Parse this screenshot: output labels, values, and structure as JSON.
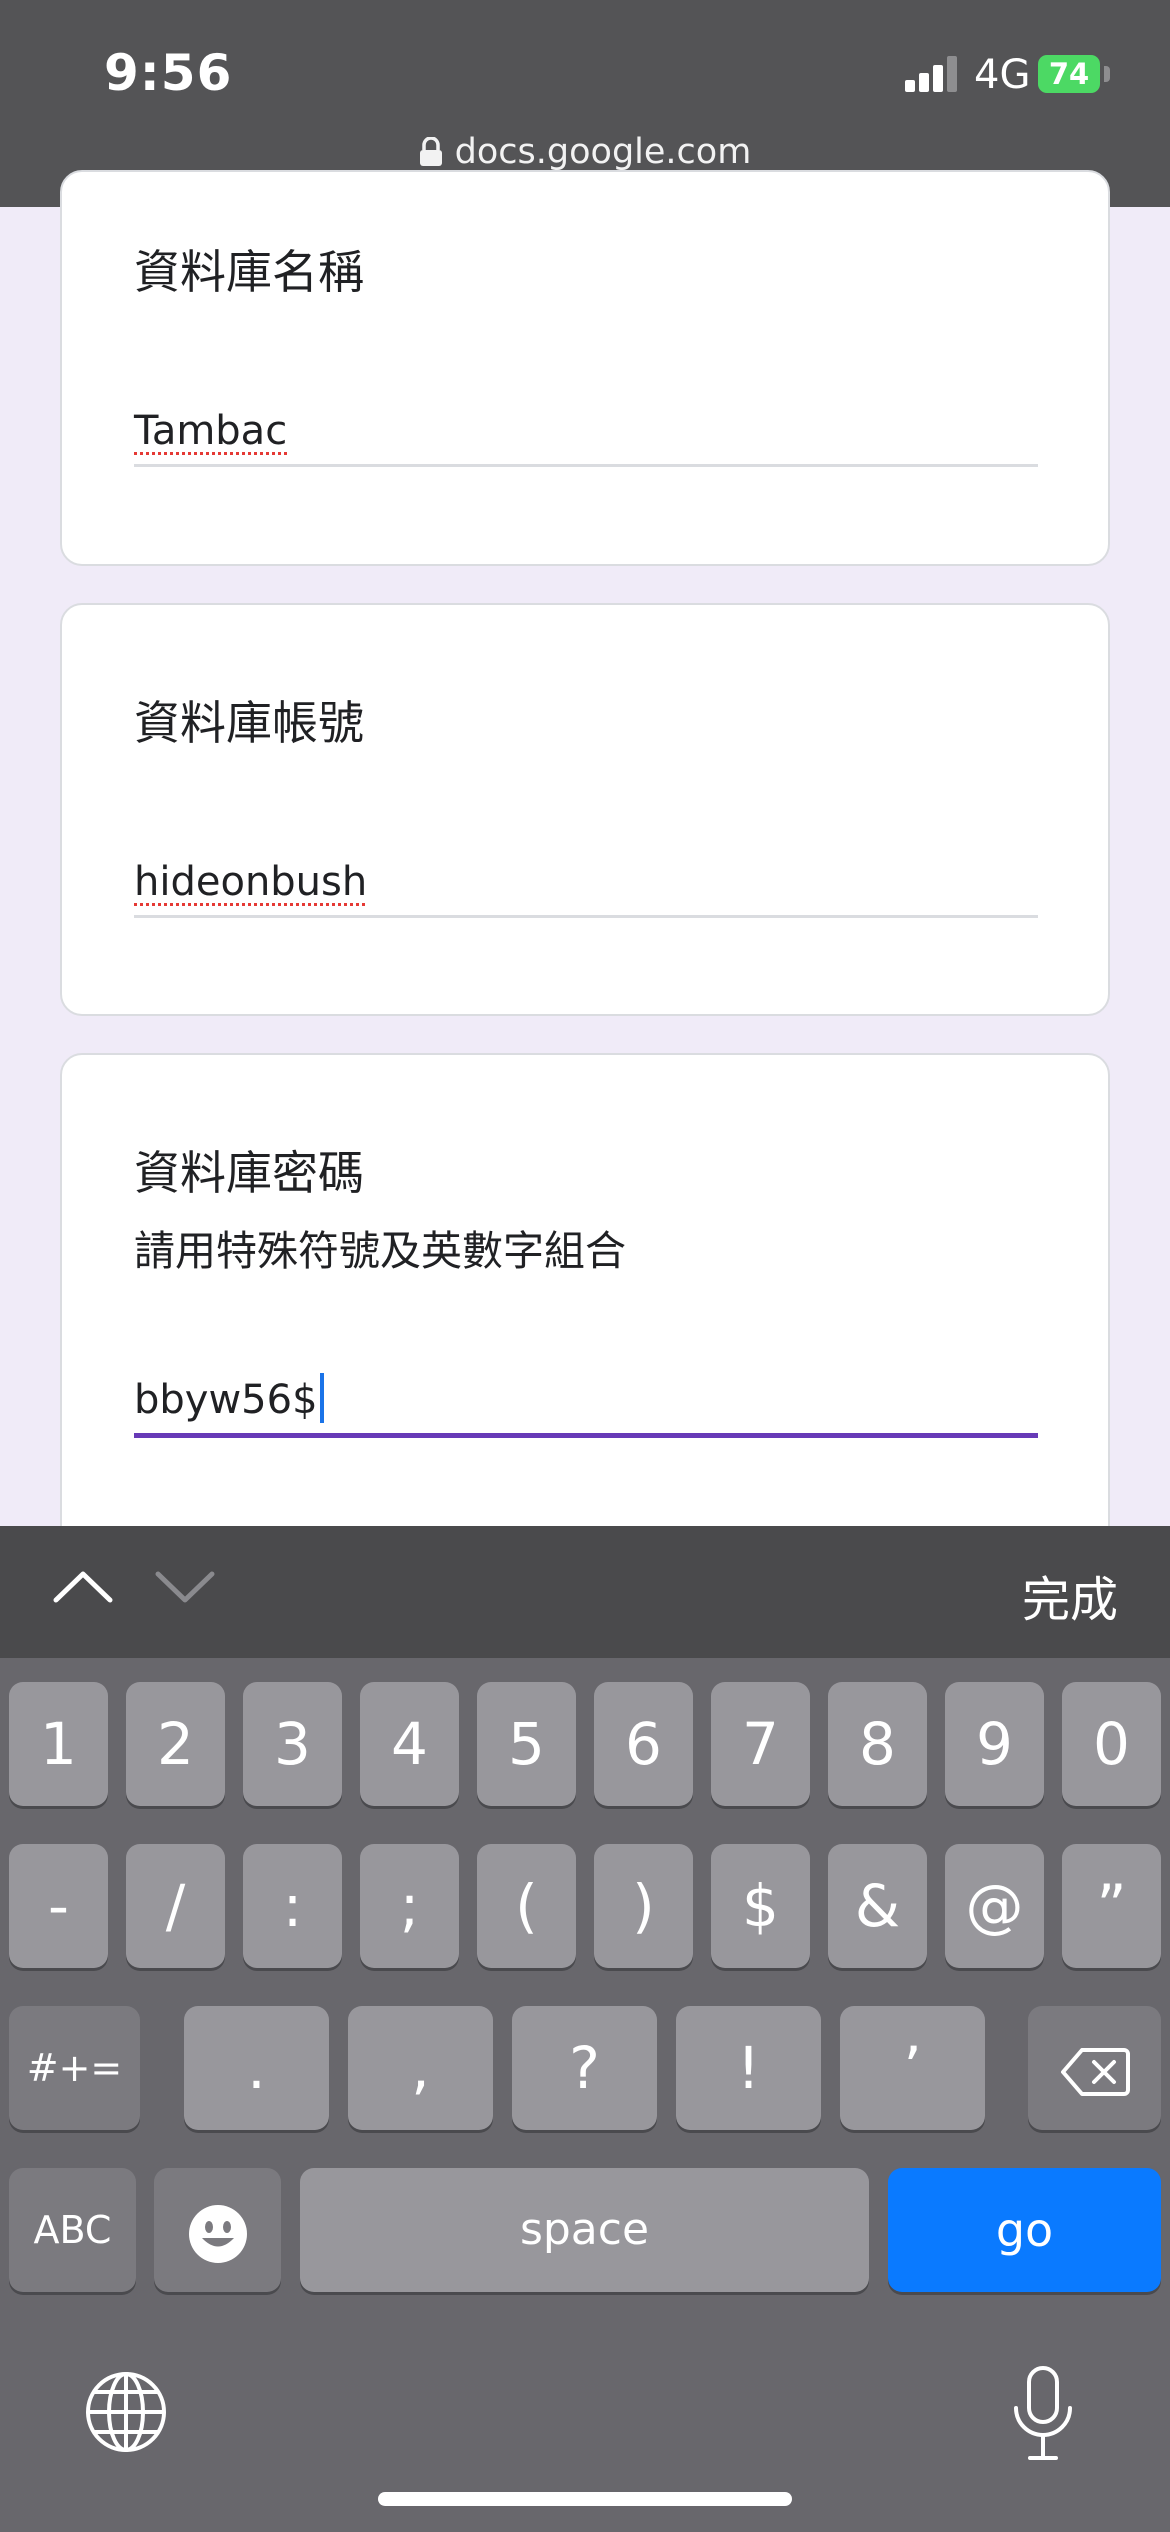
{
  "status_bar": {
    "time": "9:56",
    "network": "4G",
    "battery": "74"
  },
  "browser": {
    "url": "docs.google.com"
  },
  "form": {
    "q1": {
      "title": "資料庫名稱",
      "value": "Tambac"
    },
    "q2": {
      "title": "資料庫帳號",
      "value": "hideonbush"
    },
    "q3": {
      "title": "資料庫密碼",
      "description": "請用特殊符號及英數字組合",
      "value": "bbyw56$"
    }
  },
  "keyboard": {
    "done_label": "完成",
    "row1": [
      "1",
      "2",
      "3",
      "4",
      "5",
      "6",
      "7",
      "8",
      "9",
      "0"
    ],
    "row2": [
      "-",
      "/",
      ":",
      ";",
      "(",
      ")",
      "$",
      "&",
      "@",
      "”"
    ],
    "row3": [
      ".",
      ",",
      "?",
      "!",
      "’"
    ],
    "shift_label": "#+=",
    "abc_label": "ABC",
    "space_label": "space",
    "go_label": "go"
  },
  "icons": [
    "lock-icon",
    "signal-icon",
    "chevron-up-icon",
    "chevron-down-icon",
    "backspace-icon",
    "emoji-icon",
    "globe-icon",
    "microphone-icon"
  ]
}
